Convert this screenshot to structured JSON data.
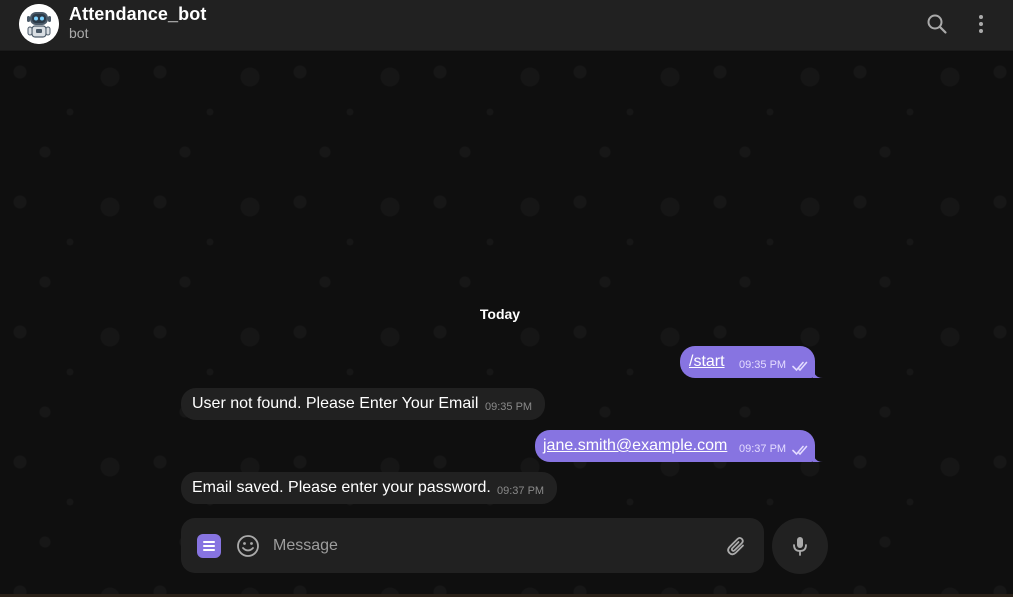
{
  "header": {
    "title": "Attendance_bot",
    "status": "bot",
    "avatar_icon": "robot-avatar-icon",
    "search_icon": "search-icon",
    "menu_icon": "more-vertical-icon"
  },
  "chat": {
    "date_separator": "Today",
    "messages": [
      {
        "direction": "out",
        "text": "/start",
        "time": "09:35 PM",
        "status": "read"
      },
      {
        "direction": "in",
        "text": "User not found. Please Enter Your Email",
        "time": "09:35 PM"
      },
      {
        "direction": "out",
        "text": "jane.smith@example.com",
        "time": "09:37 PM",
        "status": "read"
      },
      {
        "direction": "in",
        "text": "Email saved. Please enter your password.",
        "time": "09:37 PM"
      }
    ]
  },
  "composer": {
    "placeholder": "Message",
    "value": "",
    "menu_icon": "bot-menu-icon",
    "emoji_icon": "emoji-icon",
    "attach_icon": "paperclip-icon",
    "mic_icon": "microphone-icon"
  },
  "colors": {
    "accent": "#8774e1",
    "header_bg": "#212121",
    "incoming_bubble": "#212121",
    "chat_bg": "#0f0f0f"
  }
}
